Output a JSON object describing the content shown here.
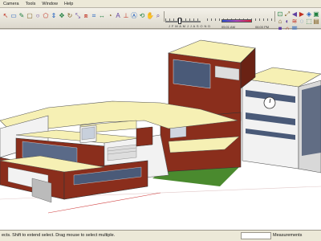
{
  "menu": {
    "items": [
      {
        "label": "Camera"
      },
      {
        "label": "Tools"
      },
      {
        "label": "Window"
      },
      {
        "label": "Help"
      }
    ]
  },
  "toolbar": {
    "months": "J F M A M J J A S O N D",
    "time_start": "05:01 AM",
    "time_end": "06:00 PM",
    "tools": [
      "select-icon",
      "eraser-icon",
      "pencil-icon",
      "rectangle-icon",
      "circle-icon",
      "polygon-icon",
      "push-pull-icon",
      "move-icon",
      "rotate-icon",
      "scale-icon",
      "offset-icon",
      "tape-measure-icon",
      "dimension-icon",
      "protractor-icon",
      "text-icon",
      "axes-icon",
      "3d-text-icon",
      "orbit-icon",
      "pan-icon",
      "zoom-icon",
      "zoom-window-icon",
      "zoom-extents-icon",
      "previous-view-icon",
      "next-view-icon",
      "iso-view-icon",
      "top-view-icon",
      "front-view-icon",
      "shadows-icon",
      "fog-icon",
      "xray-icon",
      "wireframe-icon",
      "hidden-line-icon",
      "shaded-icon",
      "home-icon",
      "right-view-icon"
    ],
    "shadow_month_position": 0.42,
    "shadow_time_start_fraction": 0.22,
    "shadow_time_end_fraction": 0.68
  },
  "viewport": {
    "model": "building-model",
    "sky_color": "#ffffff",
    "ground_color": "#4a8a2e",
    "roof_color": "#f6f0b4",
    "brick_color": "#8a2e1c",
    "wall_white": "#f2f2f2"
  },
  "status": {
    "text": "ects. Shift to extend select. Drag mouse to select multiple.",
    "measurements_label": "Measurements"
  }
}
